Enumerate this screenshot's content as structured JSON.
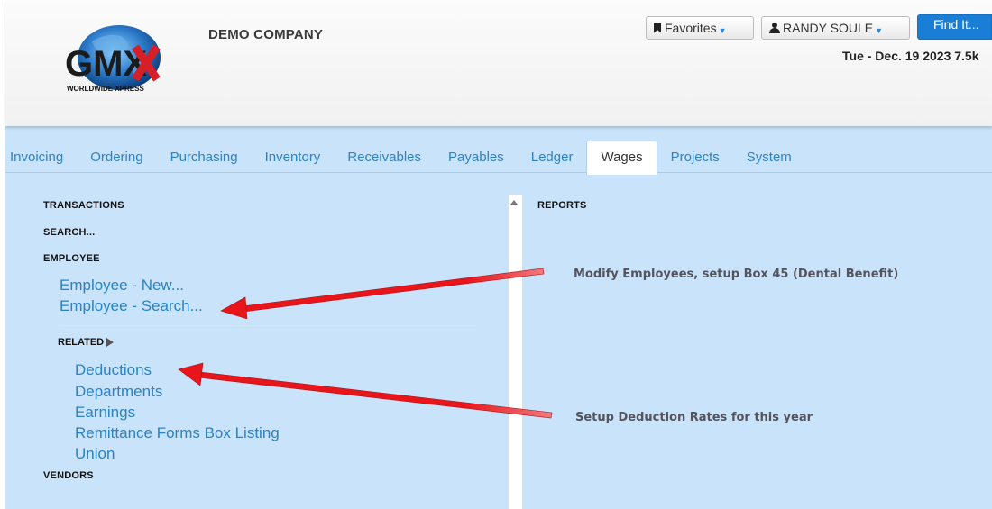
{
  "header": {
    "logo_text": "GMX",
    "logo_tagline": "WORLDWIDE XPRESS",
    "company": "DEMO COMPANY",
    "favorites_label": "Favorites",
    "user_label": "RANDY SOULE",
    "find_label": "Find It...",
    "datetime": "Tue - Dec. 19 2023 7.5k"
  },
  "tabs": [
    {
      "label": "Invoicing"
    },
    {
      "label": "Ordering"
    },
    {
      "label": "Purchasing"
    },
    {
      "label": "Inventory"
    },
    {
      "label": "Receivables"
    },
    {
      "label": "Payables"
    },
    {
      "label": "Ledger"
    },
    {
      "label": "Wages",
      "active": true
    },
    {
      "label": "Projects"
    },
    {
      "label": "System"
    }
  ],
  "left": {
    "transactions": "TRANSACTIONS",
    "search": "SEARCH...",
    "employee": "EMPLOYEE",
    "employee_links": [
      "Employee - New...",
      "Employee - Search..."
    ],
    "related": "RELATED",
    "related_links": [
      "Deductions",
      "Departments",
      "Earnings",
      "Remittance Forms Box Listing",
      "Union"
    ],
    "vendors": "VENDORS"
  },
  "right": {
    "reports": "REPORTS"
  },
  "annotations": {
    "employees_note": "Modify Employees, setup Box 45 (Dental Benefit)",
    "deductions_note": "Setup Deduction Rates for this year"
  },
  "colors": {
    "page_bg": "#c9e3fb",
    "link": "#2983c4",
    "find_button": "#1a7ed6",
    "arrow": "#e8161b"
  }
}
